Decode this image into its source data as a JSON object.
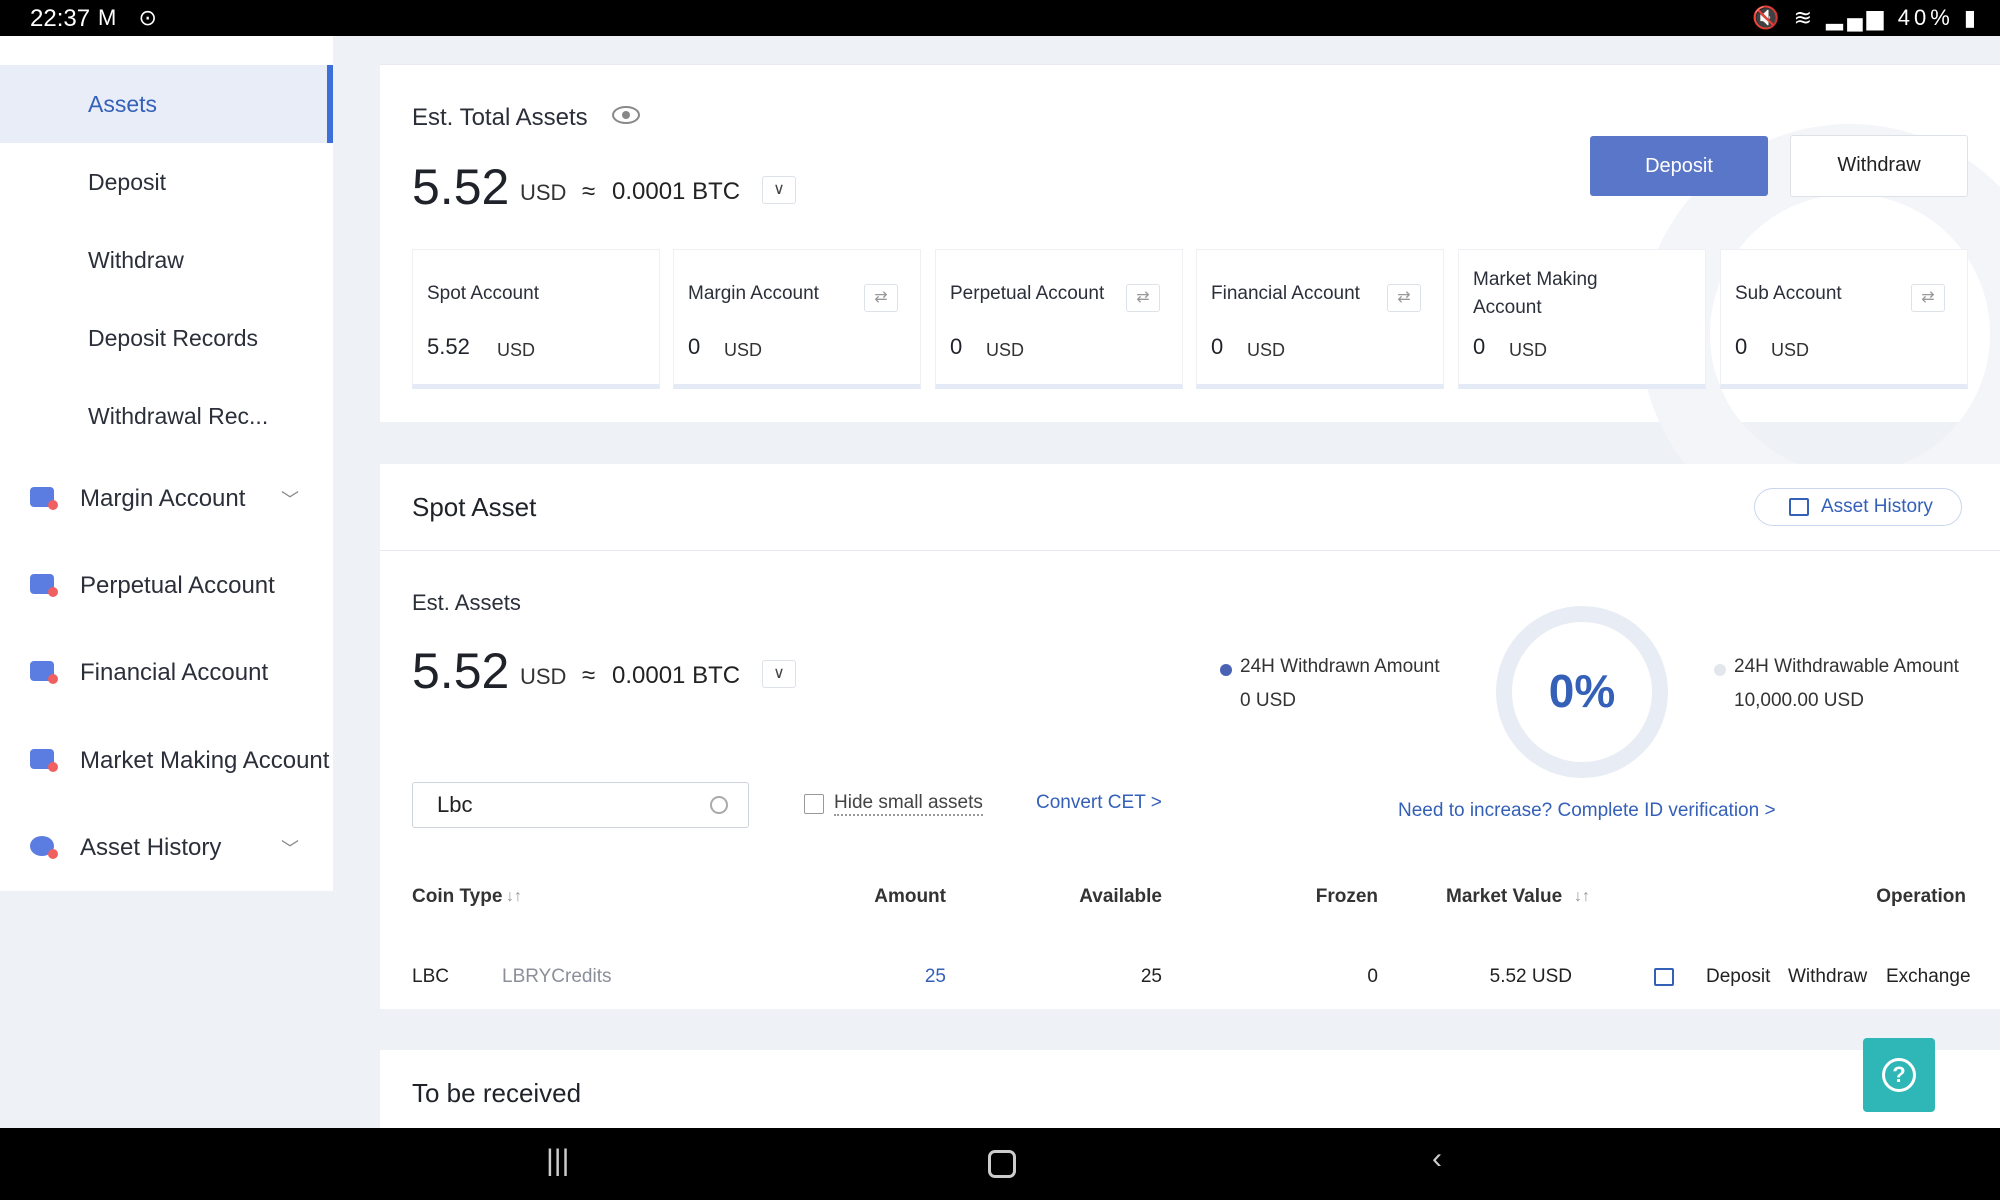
{
  "status_bar": {
    "time": "22:37",
    "left_icons": "M ⊙",
    "battery": "40%"
  },
  "sidebar": {
    "items": [
      {
        "label": "Assets",
        "active": true
      },
      {
        "label": "Deposit"
      },
      {
        "label": "Withdraw"
      },
      {
        "label": "Deposit Records"
      },
      {
        "label": "Withdrawal Rec..."
      }
    ],
    "groups": [
      {
        "label": "Margin Account",
        "icon": "margin-account-icon",
        "expandable": true
      },
      {
        "label": "Perpetual Account",
        "icon": "perpetual-account-icon"
      },
      {
        "label": "Financial Account",
        "icon": "financial-account-icon"
      },
      {
        "label": "Market Making Account",
        "icon": "market-making-icon"
      },
      {
        "label": "Asset History",
        "icon": "asset-history-icon",
        "expandable": true
      }
    ]
  },
  "overview": {
    "title": "Est. Total Assets",
    "value": "5.52",
    "unit": "USD",
    "approx": "≈",
    "btc": "0.0001 BTC",
    "deposit_btn": "Deposit",
    "withdraw_btn": "Withdraw",
    "accounts": [
      {
        "name": "Spot Account",
        "value": "5.52",
        "unit": "USD",
        "transfer": false
      },
      {
        "name": "Margin Account",
        "value": "0",
        "unit": "USD",
        "transfer": true
      },
      {
        "name": "Perpetual Account",
        "value": "0",
        "unit": "USD",
        "transfer": true
      },
      {
        "name": "Financial Account",
        "value": "0",
        "unit": "USD",
        "transfer": true
      },
      {
        "name": "Market Making Account",
        "value": "0",
        "unit": "USD",
        "transfer": false
      },
      {
        "name": "Sub Account",
        "value": "0",
        "unit": "USD",
        "transfer": true
      }
    ]
  },
  "spot": {
    "title": "Spot Asset",
    "history_btn": "Asset History",
    "est_label": "Est. Assets",
    "value": "5.52",
    "unit": "USD",
    "approx": "≈",
    "btc": "0.0001 BTC",
    "search_value": "Lbc",
    "hide_small": "Hide small assets",
    "convert": "Convert CET >",
    "withdrawn_label": "24H Withdrawn Amount",
    "withdrawn_value": "0 USD",
    "ring_percent": "0%",
    "withdrawable_label": "24H Withdrawable Amount",
    "withdrawable_value": "10,000.00 USD",
    "increase_text": "Need to increase?  Complete ID verification >",
    "colors": {
      "withdrawn": "#4a62b4",
      "withdrawable": "#e3e6ec"
    },
    "table": {
      "headers": {
        "coin_type": "Coin Type",
        "amount": "Amount",
        "available": "Available",
        "frozen": "Frozen",
        "market_value": "Market Value",
        "operation": "Operation"
      },
      "rows": [
        {
          "coin": "LBC",
          "name": "LBRYCredits",
          "amount": "25",
          "available": "25",
          "frozen": "0",
          "market_value": "5.52 USD",
          "ops": [
            "Deposit",
            "Withdraw",
            "Exchange"
          ]
        }
      ]
    }
  },
  "receive": {
    "title": "To be received"
  },
  "help": "?",
  "accent": "#3460b8"
}
